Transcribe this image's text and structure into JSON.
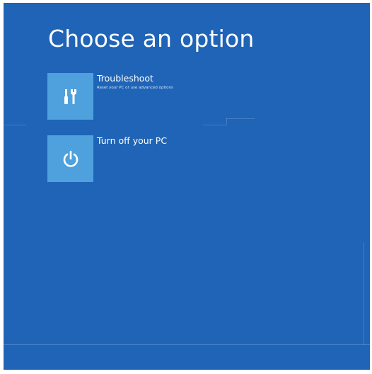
{
  "page": {
    "title": "Choose an option",
    "background_color": "#1f64b7",
    "tile_color": "#4fa1dd"
  },
  "options": [
    {
      "title": "Troubleshoot",
      "description": "Reset your PC or use advanced options",
      "icon": "tools-icon"
    },
    {
      "title": "Turn off your PC",
      "description": "",
      "icon": "power-icon"
    }
  ]
}
